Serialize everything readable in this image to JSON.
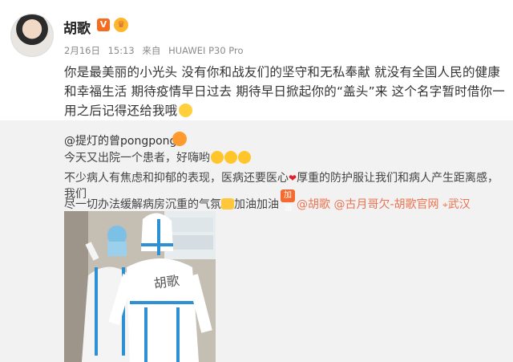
{
  "post": {
    "author": "胡歌",
    "vip_badge": "V",
    "meta": {
      "date": "2月16日",
      "time": "15:13",
      "source_prefix": "来自",
      "source": "HUAWEI P30 Pro"
    },
    "text": "你是最美丽的小光头 没有你和战友们的坚守和无私奉献 就没有全国人民的健康和幸福生活 期待疫情早日过去 期待早日掀起你的“盖头”来 这个名字暂时借你一用之后记得还给我哦"
  },
  "repost": {
    "user": "@提灯的曾pongpong",
    "line1": "今天又出院一个患者，好嗨哟",
    "line2_a": "不少病人有焦虑和抑郁的表现，医病还要医心",
    "line2_b": "厚重的防护服让我们和病人产生距离感，我们",
    "line3_a": "尽一切办法缓解病房沉重的气氛",
    "line3_b": "加油加油",
    "cheer_icon": "加油",
    "mentions": [
      "@胡歌",
      "@古月哥欠-胡歌官网"
    ],
    "location": "武汉",
    "photo_text": "胡歌"
  },
  "colors": {
    "link": "#eb7350",
    "repost_bg": "#f2f2f2",
    "suit": "#ffffff",
    "tape": "#2d8fd4"
  }
}
